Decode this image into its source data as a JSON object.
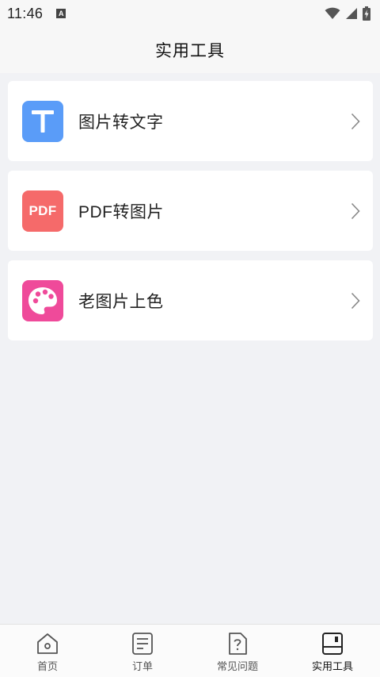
{
  "status_bar": {
    "time": "11:46",
    "notification_badge": "A",
    "icons": [
      "wifi-icon",
      "signal-icon",
      "battery-charging-icon"
    ]
  },
  "header": {
    "title": "实用工具"
  },
  "tools": [
    {
      "label": "图片转文字",
      "icon": "text-t-icon",
      "icon_color": "#5a9cf8"
    },
    {
      "label": "PDF转图片",
      "icon": "pdf-icon",
      "icon_text": "PDF",
      "icon_color": "#f56a6a"
    },
    {
      "label": "老图片上色",
      "icon": "palette-icon",
      "icon_color": "#ef4a9a"
    }
  ],
  "tabbar": {
    "items": [
      {
        "label": "首页",
        "icon": "home-icon",
        "active": false
      },
      {
        "label": "订单",
        "icon": "order-list-icon",
        "active": false
      },
      {
        "label": "常见问题",
        "icon": "faq-icon",
        "active": false
      },
      {
        "label": "实用工具",
        "icon": "tools-icon",
        "active": true
      }
    ]
  }
}
